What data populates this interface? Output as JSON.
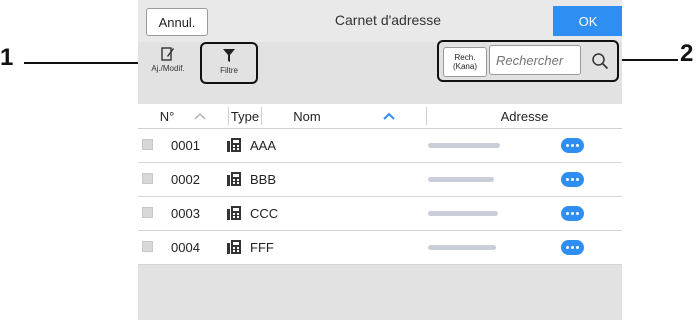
{
  "topbar": {
    "cancel_label": "Annul.",
    "title": "Carnet d'adresse",
    "ok_label": "OK"
  },
  "toolbar": {
    "edit_label": "Aj./Modif.",
    "filter_label": "Filtre",
    "kana_label": "Rech.\n(Kana)",
    "search_placeholder": "Rechercher"
  },
  "table": {
    "columns": {
      "number": "N°",
      "type": "Type",
      "name": "Nom",
      "address": "Adresse"
    },
    "rows": [
      {
        "number": "0001",
        "name": "AAA"
      },
      {
        "number": "0002",
        "name": "BBB"
      },
      {
        "number": "0003",
        "name": "CCC"
      },
      {
        "number": "0004",
        "name": "FFF"
      }
    ]
  },
  "callouts": {
    "left": "1",
    "right": "2"
  },
  "colors": {
    "accent": "#2f8ef2"
  }
}
